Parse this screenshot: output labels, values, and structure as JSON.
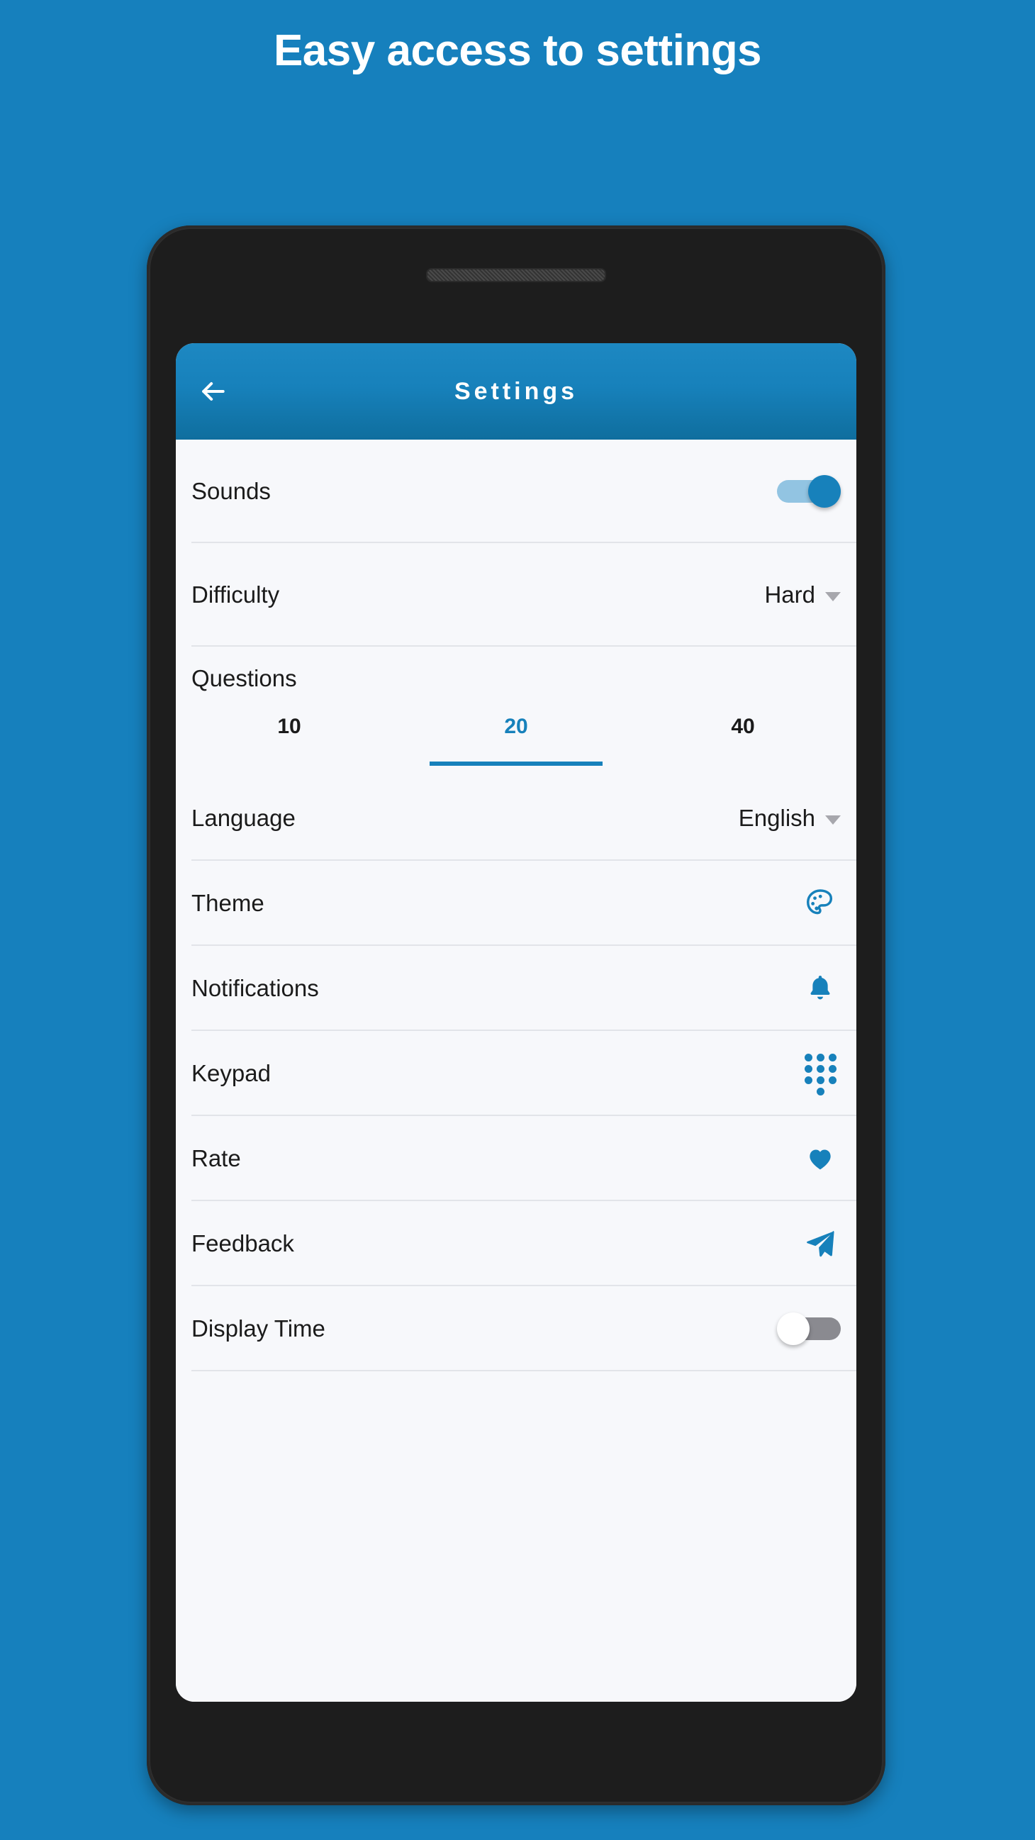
{
  "promo": {
    "headline": "Easy access to settings"
  },
  "theme_colors": {
    "background_blue": "#1680bd",
    "appbar_blue": "#1781bb",
    "accent_blue": "#1781bb",
    "toggle_on_track": "#92c4e2",
    "toggle_off_track": "#8a8a90",
    "screen_background": "#f7f8fb",
    "divider": "#e2e4e9",
    "text_primary": "#1b1b1b",
    "phone_frame": "#1d1d1d"
  },
  "appbar": {
    "back_icon": "arrow-left-icon",
    "title": "Settings"
  },
  "settings": {
    "rows": [
      {
        "id": "sounds",
        "label": "Sounds",
        "control": "toggle",
        "toggle_state": "on"
      },
      {
        "id": "difficulty",
        "label": "Difficulty",
        "control": "dropdown",
        "value": "Hard"
      },
      {
        "id": "questions",
        "label": "Questions",
        "control": "tabs",
        "tabs": [
          "10",
          "20",
          "40"
        ],
        "selected_tab": "20"
      },
      {
        "id": "language",
        "label": "Language",
        "control": "dropdown",
        "value": "English"
      },
      {
        "id": "theme",
        "label": "Theme",
        "control": "icon",
        "icon": "palette-icon"
      },
      {
        "id": "notifications",
        "label": "Notifications",
        "control": "icon",
        "icon": "bell-icon"
      },
      {
        "id": "keypad",
        "label": "Keypad",
        "control": "icon",
        "icon": "dialpad-icon"
      },
      {
        "id": "rate",
        "label": "Rate",
        "control": "icon",
        "icon": "heart-icon"
      },
      {
        "id": "feedback",
        "label": "Feedback",
        "control": "icon",
        "icon": "send-icon"
      },
      {
        "id": "display_time",
        "label": "Display Time",
        "control": "toggle",
        "toggle_state": "off"
      }
    ]
  }
}
